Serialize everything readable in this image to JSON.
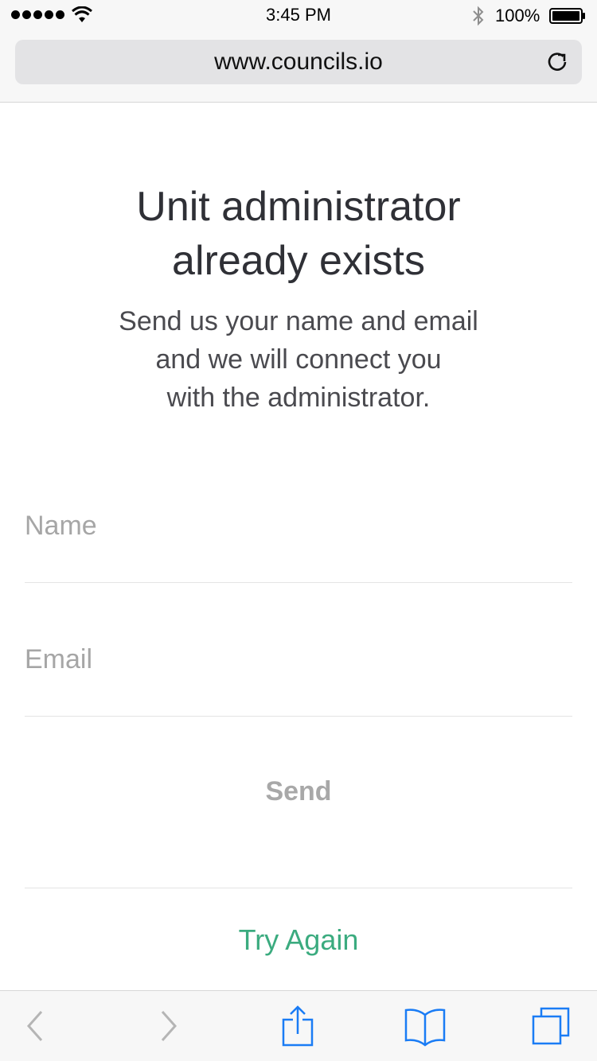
{
  "status_bar": {
    "time": "3:45 PM",
    "battery_percent": "100%",
    "icons": [
      "signal-dots-icon",
      "wifi-icon",
      "bluetooth-icon",
      "battery-icon"
    ]
  },
  "browser": {
    "url": "www.councils.io",
    "reload_icon": "reload-icon",
    "toolbar_icons": [
      "back-icon",
      "forward-icon",
      "share-icon",
      "bookmarks-icon",
      "tabs-icon"
    ],
    "accent_color": "#1a7cf5"
  },
  "content": {
    "title_line1": "Unit administrator",
    "title_line2": "already exists",
    "subtitle_line1": "Send us your name and email",
    "subtitle_line2": "and we will connect you",
    "subtitle_line3": "with the administrator."
  },
  "form": {
    "name_placeholder": "Name",
    "name_value": "",
    "email_placeholder": "Email",
    "email_value": "",
    "send_label": "Send",
    "try_again_label": "Try Again",
    "try_again_color": "#3bab7f"
  }
}
